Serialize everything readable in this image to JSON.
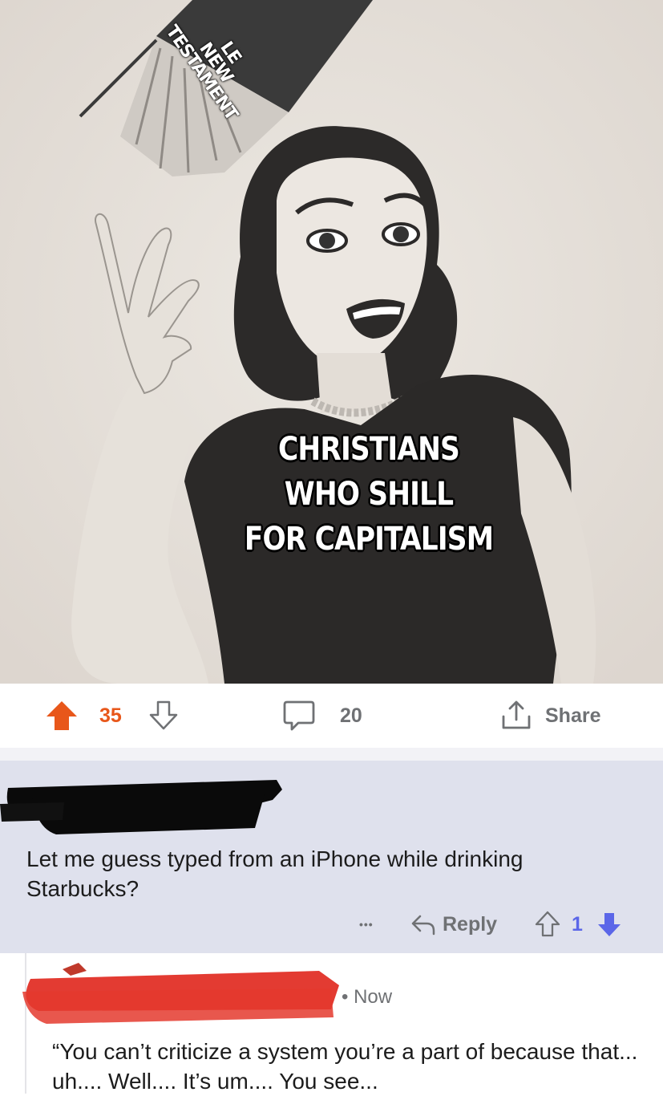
{
  "meme": {
    "book_text": [
      "LE",
      "NEW",
      "TESTAMENT"
    ],
    "caption": [
      "CHRISTIANS",
      "WHO SHILL",
      "FOR CAPITALISM"
    ]
  },
  "post_actions": {
    "upvote_count": "35",
    "comment_count": "20",
    "share_label": "Share"
  },
  "comment": {
    "text": "Let me guess typed from an iPhone while drinking Starbucks?",
    "more_label": "•••",
    "reply_label": "Reply",
    "vote_count": "1"
  },
  "reply": {
    "time": "• Now",
    "text": "“You can’t criticize a system you’re a part of because that... uh.... Well.... It’s um.... You see..."
  },
  "colors": {
    "upvote_active": "#e8571a",
    "downvote_active": "#5b66e8",
    "comment_bg": "#dfe1ed",
    "muted_text": "#6f7174",
    "redaction_red": "#e0261c"
  }
}
